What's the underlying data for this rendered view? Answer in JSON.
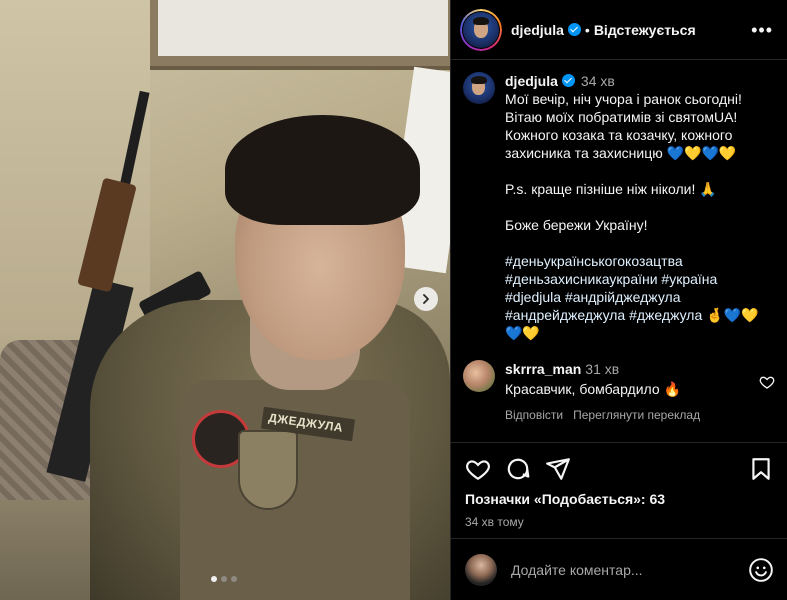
{
  "header": {
    "username": "djedjula",
    "separator": "•",
    "follow_label": "Відстежується",
    "more_label": "•••"
  },
  "caption": {
    "username": "djedjula",
    "time": "34 хв",
    "line1": "Мої вечір, ніч учора  і ранок сьогодні!",
    "line2": "Вітаю моїх побратимів зі святомUA!",
    "line3": "Кожного козака та козачку, кожного",
    "line4": "захисника та захисницю 💙💛💙💛",
    "line5": "P.s. краще пізніше ніж ніколи! 🙏",
    "line6": "Боже бережи Україну!",
    "tags1": "#деньукраїнськогокозацтва",
    "tags2": "#деньзахисникаукраїни #україна",
    "tags3": "#djedjula #андрійджеджула",
    "tags4": "#андрейджеджула #джеджула 🤞💙💛",
    "tags5": "💙💛"
  },
  "comment": {
    "username": "skrrra_man",
    "time": "31 хв",
    "text": "Красавчик, бомбардило 🔥",
    "reply_label": "Відповісти",
    "translate_label": "Переглянути переклад"
  },
  "likes_text": "Позначки «Подобається»: 63",
  "time_ago": "34 хв тому",
  "add_comment": {
    "placeholder": "Додайте коментар..."
  },
  "photo": {
    "patch_text": "ДЖЕДЖУЛА"
  },
  "colors": {
    "verified": "#0095f6",
    "background": "#000000",
    "secondary_text": "#a8a8a8"
  },
  "icons": [
    "verified-icon",
    "more-icon",
    "chevron-right-icon",
    "heart-icon",
    "comment-icon",
    "share-icon",
    "bookmark-icon",
    "emoji-icon"
  ]
}
